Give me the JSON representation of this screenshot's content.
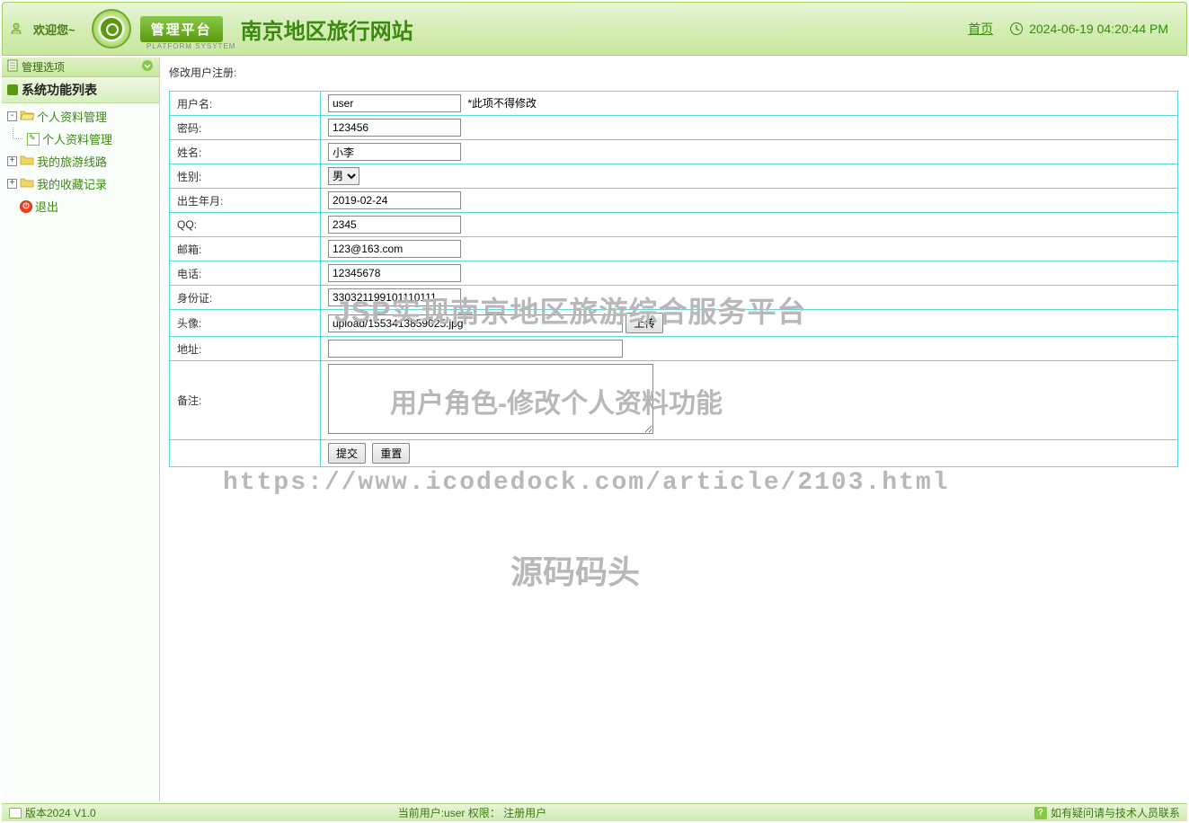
{
  "header": {
    "welcome": "欢迎您~",
    "platform_label": "管理平台",
    "platform_sub": "PLATFORM SYSYTEM",
    "site_title": "南京地区旅行网站",
    "home_link": "首页",
    "datetime": "2024-06-19 04:20:44 PM"
  },
  "sidebar": {
    "header_label": "管理选项",
    "tree_title": "系统功能列表",
    "items": [
      {
        "label": "个人资料管理",
        "expanded": true,
        "sub": [
          {
            "label": "个人资料管理"
          }
        ]
      },
      {
        "label": "我的旅游线路",
        "expanded": false
      },
      {
        "label": "我的收藏记录",
        "expanded": false
      },
      {
        "label": "退出",
        "is_exit": true
      }
    ]
  },
  "main": {
    "title": "修改用户注册:",
    "fields": {
      "username_label": "用户名:",
      "username_value": "user",
      "username_note": "*此项不得修改",
      "password_label": "密码:",
      "password_value": "123456",
      "name_label": "姓名:",
      "name_value": "小李",
      "gender_label": "性别:",
      "gender_value": "男",
      "birth_label": "出生年月:",
      "birth_value": "2019-02-24",
      "qq_label": "QQ:",
      "qq_value": "2345",
      "email_label": "邮箱:",
      "email_value": "123@163.com",
      "phone_label": "电话:",
      "phone_value": "12345678",
      "idcard_label": "身份证:",
      "idcard_value": "330321199101110111",
      "avatar_label": "头像:",
      "avatar_value": "upload/1553413859025.jpg",
      "upload_btn": "上传",
      "address_label": "地址:",
      "address_value": "",
      "remark_label": "备注:",
      "remark_value": "",
      "submit_btn": "提交",
      "reset_btn": "重置"
    }
  },
  "watermarks": {
    "wm1": "JSP实现南京地区旅游综合服务平台",
    "wm2": "用户角色-修改个人资料功能",
    "wm3": "https://www.icodedock.com/article/2103.html",
    "wm4": "源码码头"
  },
  "footer": {
    "version": "版本2024 V1.0",
    "current_user": "当前用户:user 权限：  注册用户",
    "help": "如有疑问请与技术人员联系"
  }
}
